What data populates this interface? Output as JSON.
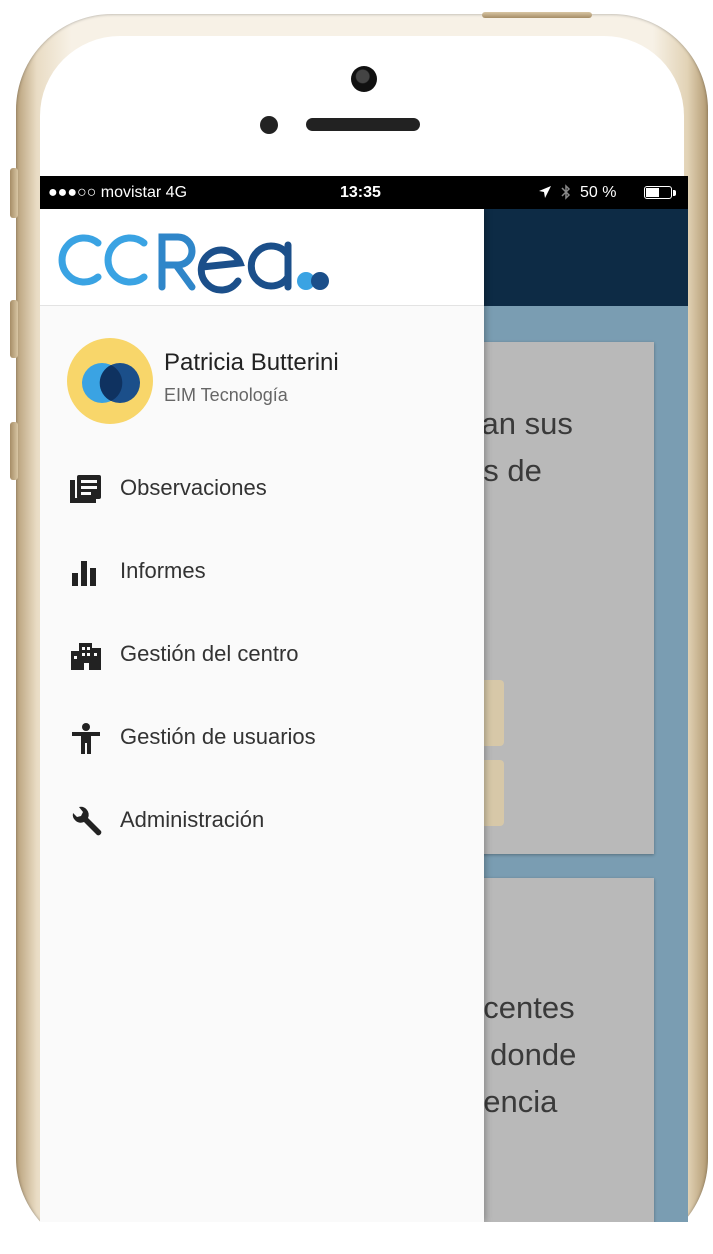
{
  "status_bar": {
    "carrier": "●●●○○ movistar  4G",
    "time": "13:35",
    "battery_text": "50 %",
    "battery_level": 0.5
  },
  "drawer": {
    "logo_alt": "ccrea",
    "user": {
      "name": "Patricia Butterini",
      "organization": "EIM Tecnología"
    },
    "menu": [
      {
        "label": "Observaciones",
        "icon": "observations-icon"
      },
      {
        "label": "Informes",
        "icon": "reports-icon"
      },
      {
        "label": "Gestión del centro",
        "icon": "building-icon"
      },
      {
        "label": "Gestión de usuarios",
        "icon": "user-icon"
      },
      {
        "label": "Administración",
        "icon": "wrench-icon"
      }
    ]
  },
  "background": {
    "card_1_text": "san sus\nos de",
    "card_2_text": "ocentes\ns donde\nriencia"
  },
  "colors": {
    "header": "#0d2b45",
    "content": "#7a9db2",
    "card": "#b9b9b9",
    "logo_light": "#3aa3e3",
    "logo_dark": "#1b4f8a",
    "avatar_bg": "#f8d66a"
  }
}
